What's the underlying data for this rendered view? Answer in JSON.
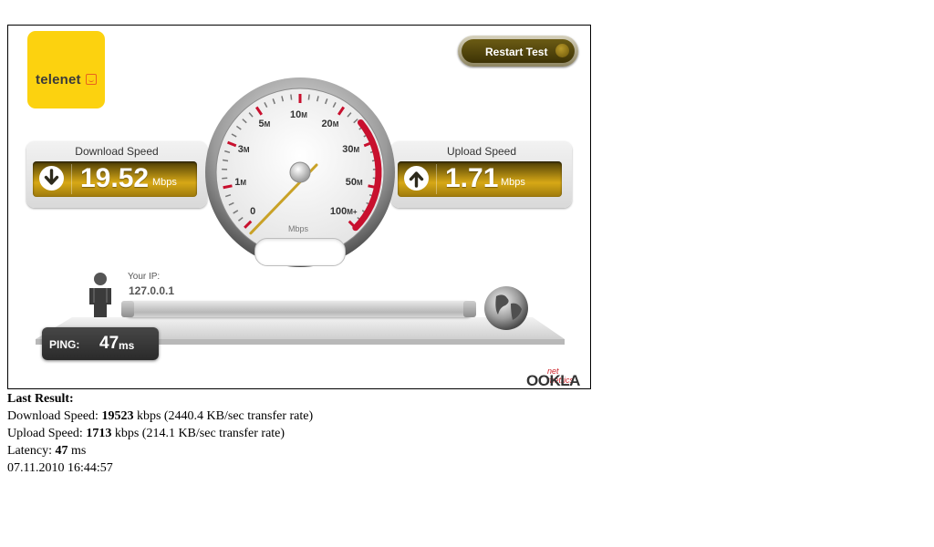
{
  "logo": {
    "text": "telenet",
    "color": "#fcd20f"
  },
  "restart_button": {
    "label": "Restart Test"
  },
  "download": {
    "title": "Download Speed",
    "value": "19.52",
    "unit": "Mbps",
    "icon": "arrow-down-icon"
  },
  "upload": {
    "title": "Upload Speed",
    "value": "1.71",
    "unit": "Mbps",
    "icon": "arrow-up-icon"
  },
  "gauge": {
    "scale_labels": [
      "0",
      "1M",
      "3M",
      "5M",
      "10M",
      "20M",
      "30M",
      "50M",
      "100M+"
    ],
    "unit": "Mbps",
    "needle_value_mbps": 0.0,
    "accent": "#c8102e"
  },
  "ip": {
    "label": "Your IP:",
    "value": "127.0.0.1"
  },
  "ping": {
    "label": "PING:",
    "value": "47",
    "unit": "ms"
  },
  "brand": {
    "net_metrics": "net metrics",
    "name": "OOKLA"
  },
  "results": {
    "heading": "Last Result:",
    "download_prefix": "Download Speed: ",
    "download_kbps": "19523",
    "download_suffix": " kbps (2440.4 KB/sec transfer rate)",
    "upload_prefix": "Upload Speed: ",
    "upload_kbps": "1713",
    "upload_suffix": " kbps (214.1 KB/sec transfer rate)",
    "latency_prefix": "Latency: ",
    "latency_ms": "47",
    "latency_suffix": " ms",
    "timestamp": "07.11.2010 16:44:57"
  }
}
